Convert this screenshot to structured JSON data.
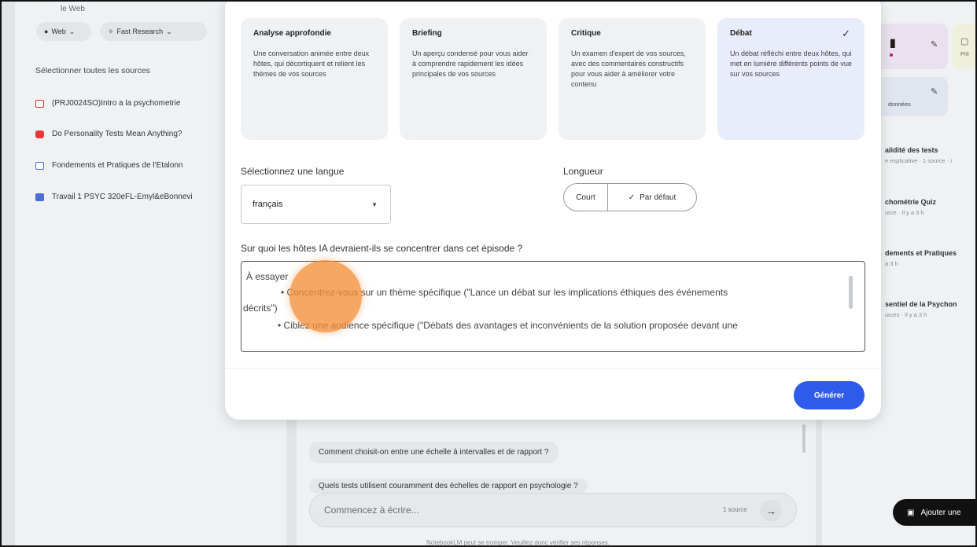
{
  "left_panel": {
    "web_label": "le Web",
    "chip_web": "Web",
    "chip_research": "Fast Research",
    "select_all": "Sélectionner toutes les sources",
    "sources": [
      {
        "title": "(PRJ0024SO)Intro a la psychometrie"
      },
      {
        "title": "Do Personality Tests Mean Anything?"
      },
      {
        "title": "Fondements et Pratiques de l'Étalonn"
      },
      {
        "title": "Travail 1 PSYC 320eFL-Emyl&eBonnevi"
      }
    ]
  },
  "modal": {
    "formats": [
      {
        "title": "Analyse approfondie",
        "description": "Une conversation animée entre deux hôtes, qui décortiquent et relient les thèmes de vos sources",
        "selected": false
      },
      {
        "title": "Briefing",
        "description": "Un aperçu condensé pour vous aider à comprendre rapidement les idées principales de vos sources",
        "selected": false
      },
      {
        "title": "Critique",
        "description": "Un examen d'expert de vos sources, avec des commentaires constructifs pour vous aider à améliorer votre contenu",
        "selected": false
      },
      {
        "title": "Débat",
        "description": "Un débat réfléchi entre deux hôtes, qui met en lumière différents points de vue sur vos sources",
        "selected": true
      }
    ],
    "language_label": "Sélectionnez une langue",
    "language_value": "français",
    "length_label": "Longueur",
    "length_short": "Court",
    "length_default": "Par défaut",
    "focus_label": "Sur quoi les hôtes IA devraient-ils se concentrer dans cet épisode ?",
    "textarea_lines": [
      "À essayer",
      "• Concentrez-vous sur un thème spécifique (\"Lance un débat sur les implications éthiques des événements",
      "décrits\")",
      "• Ciblez une audience spécifique (\"Débats des avantages et inconvénients de la solution proposée devant une"
    ],
    "generate": "Générer"
  },
  "center": {
    "suggestions": [
      "Comment choisit-on entre une échelle à intervalles et de rapport ?",
      "Quels tests utilisent couramment des échelles de rapport en psychologie ?"
    ],
    "composer_placeholder": "Commencez à écrire...",
    "source_count": "1 source",
    "disclaimer": "NotebookLM peut se tromper. Veuillez donc vérifier ses réponses."
  },
  "right_panel": {
    "tile_data": "données",
    "tile_pre": "Pré",
    "notes": [
      {
        "title": "alidité des tests",
        "sub": "e explicative · 1 source · i"
      },
      {
        "title": "chométrie Quiz",
        "sub": "urce · Il y a 3 h"
      },
      {
        "title": "dements et Pratiques",
        "sub": "a 3 h"
      },
      {
        "title": "sentiel de la Psychon",
        "sub": "urces · Il y a 3 h"
      }
    ],
    "add_note": "Ajouter une"
  },
  "colors": {
    "primary_button": "#2f5bea",
    "selected_card": "#e8ecfb",
    "cursor_highlight": "#f38e37"
  }
}
